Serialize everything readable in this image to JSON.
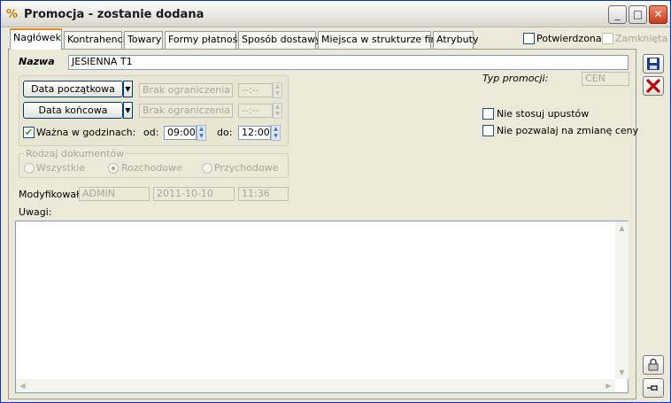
{
  "window": {
    "title": "Promocja - zostanie dodana",
    "app_icon": "%",
    "min": "_",
    "max": "□",
    "close": "✕"
  },
  "tabs": [
    {
      "label": "Nagłówek",
      "active": true
    },
    {
      "label": "Kontrahenci"
    },
    {
      "label": "Towary"
    },
    {
      "label": "Formy płatności"
    },
    {
      "label": "Sposób dostawy"
    },
    {
      "label": "Miejsca w strukturze firmy"
    },
    {
      "label": "Atrybuty"
    }
  ],
  "header_flags": {
    "confirmed_label": "Potwierdzona",
    "closed_label": "Zamknięta"
  },
  "name": {
    "label": "Nazwa",
    "value": "JESIENNA T1"
  },
  "dates": {
    "start_button": "Data początkowa",
    "end_button": "Data końcowa",
    "start_value": "Brak ograniczenia",
    "end_value": "Brak ograniczenia",
    "start_time": "--:--",
    "end_time": "--:--",
    "hours_label": "Ważna w godzinach:",
    "from_label": "od:",
    "from_value": "09:00",
    "to_label": "do:",
    "to_value": "12:00"
  },
  "promo_type": {
    "label": "Typ promocji:",
    "value": "CEN"
  },
  "options": {
    "no_discounts": "Nie stosuj upustów",
    "no_price_change": "Nie pozwalaj na zmianę ceny"
  },
  "doc_kind": {
    "legend": "Rodzaj dokumentów",
    "all": "Wszystkie",
    "outgoing": "Rozchodowe",
    "incoming": "Przychodowe",
    "selected": "Rozchodowe"
  },
  "modified": {
    "label": "Modyfikował:",
    "user": "ADMIN",
    "date": "2011-10-10",
    "time": "11:36"
  },
  "remarks": {
    "label": "Uwagi:",
    "value": ""
  },
  "side_icons": [
    "save-icon",
    "cancel-icon",
    "lock-icon",
    "pin-icon"
  ],
  "colors": {
    "accent_tab": "#e68b2c",
    "cancel_red": "#c00000",
    "save_blue": "#1c3f94",
    "check_green": "#21a121"
  }
}
